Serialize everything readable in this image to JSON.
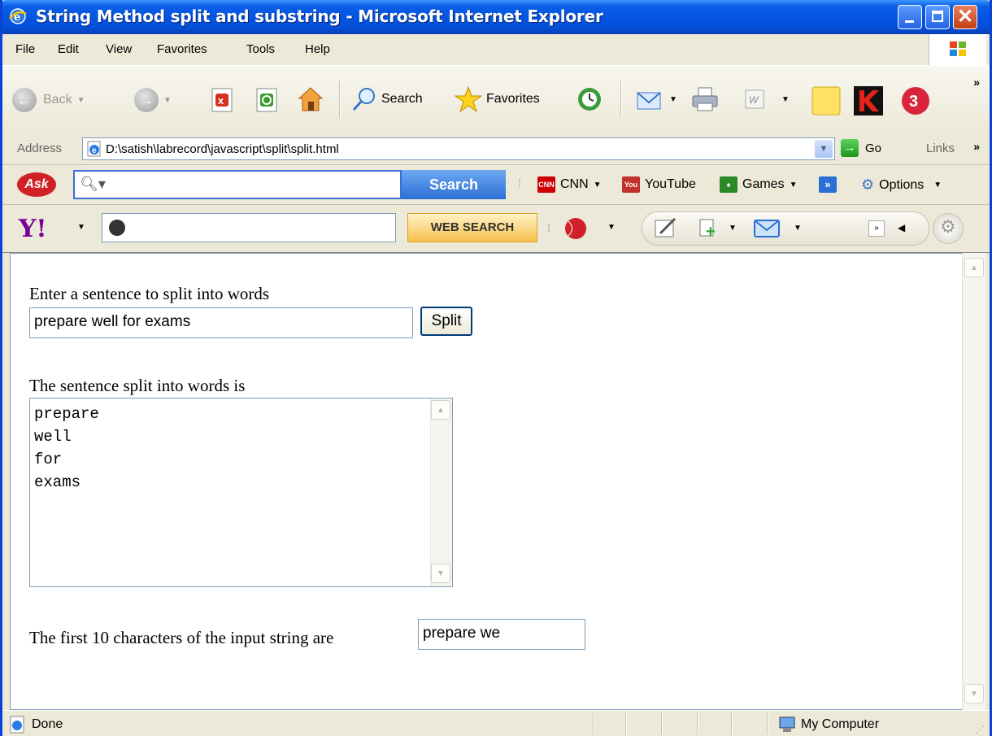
{
  "window": {
    "title": "String Method split and substring - Microsoft Internet Explorer"
  },
  "menu": [
    "File",
    "Edit",
    "View",
    "Favorites",
    "Tools",
    "Help"
  ],
  "toolbar": {
    "back_label": "Back",
    "search_label": "Search",
    "favorites_label": "Favorites"
  },
  "address": {
    "label": "Address",
    "url": "D:\\satish\\labrecord\\javascript\\split\\split.html",
    "go_label": "Go",
    "links_label": "Links"
  },
  "ask_toolbar": {
    "search_placeholder": "",
    "search_button": "Search",
    "cnn_label": "CNN",
    "youtube_label": "YouTube",
    "games_label": "Games",
    "options_label": "Options"
  },
  "yahoo_toolbar": {
    "search_value": "",
    "search_button": "WEB SEARCH"
  },
  "page": {
    "prompt": "Enter a sentence to split into words",
    "input_value": "prepare well for exams",
    "split_button": "Split",
    "result_label": "The sentence split into words is",
    "words": [
      "prepare",
      "well",
      "for",
      "exams"
    ],
    "substring_label": "The first 10 characters of the input string are",
    "substring_value": "prepare we"
  },
  "status": {
    "text": "Done",
    "zone": "My Computer"
  },
  "colors": {
    "title_bar": "#0554e3",
    "close_button": "#c33d14",
    "ask_brand": "#d12127",
    "yahoo_brand": "#7b0099",
    "go_button": "#1e961e"
  }
}
